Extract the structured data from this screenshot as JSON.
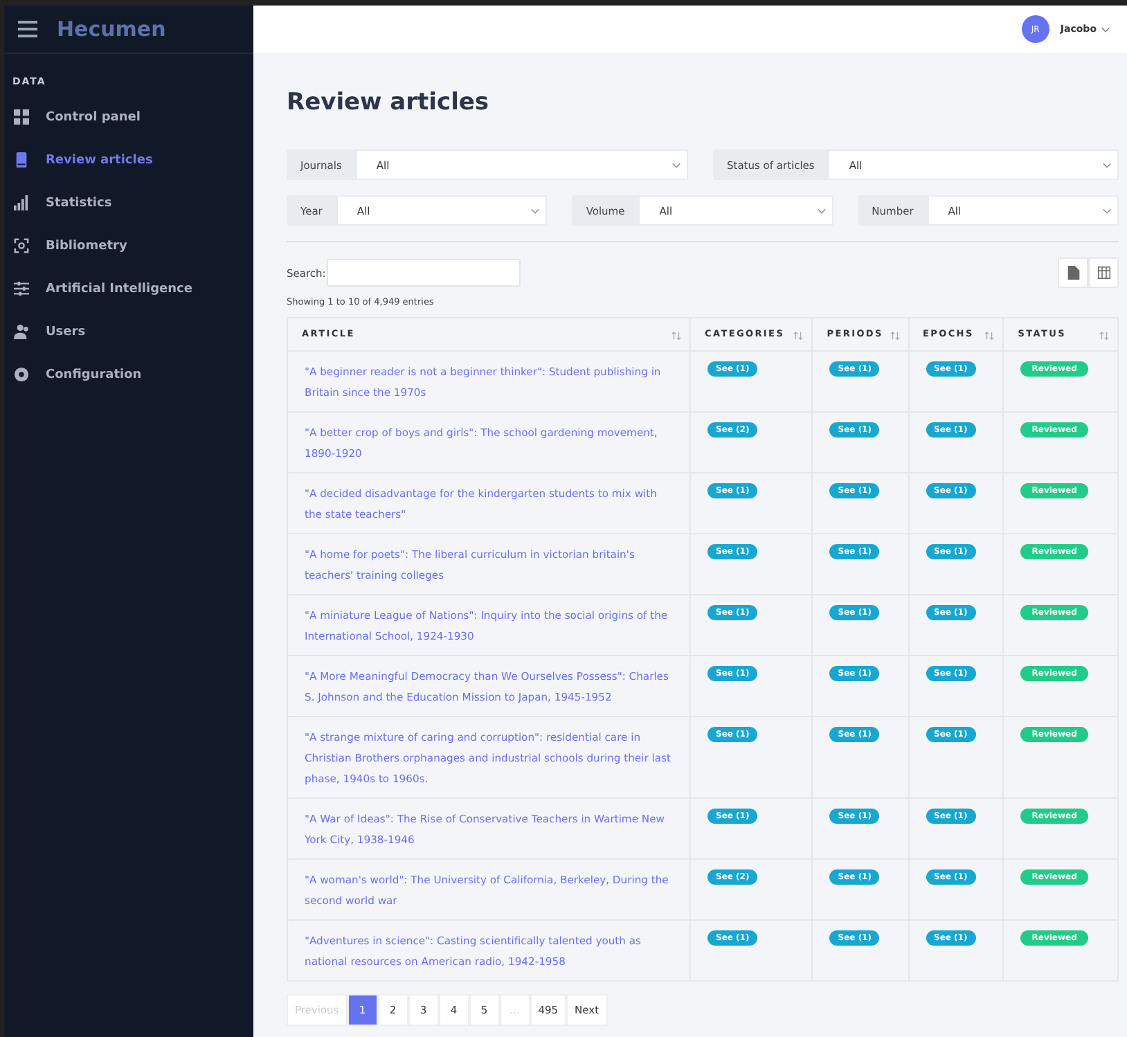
{
  "brand": "Hecumen",
  "sidebar": {
    "section": "DATA",
    "items": [
      {
        "label": "Control panel",
        "kind": "grid",
        "selected": false
      },
      {
        "label": "Review articles",
        "kind": "book",
        "selected": true
      },
      {
        "label": "Statistics",
        "kind": "bars",
        "selected": false
      },
      {
        "label": "Bibliometry",
        "kind": "scan",
        "selected": false
      },
      {
        "label": "Artificial Intelligence",
        "kind": "sliders",
        "selected": false
      },
      {
        "label": "Users",
        "kind": "users",
        "selected": false
      },
      {
        "label": "Configuration",
        "kind": "gear",
        "selected": false
      }
    ]
  },
  "user": {
    "initials": "JR",
    "name": "Jacobo"
  },
  "title": "Review articles",
  "filters": [
    [
      {
        "label": "Journals",
        "value": "All"
      },
      {
        "label": "Status of articles",
        "value": "All"
      }
    ],
    [
      {
        "label": "Year",
        "value": "All"
      },
      {
        "label": "Volume",
        "value": "All"
      },
      {
        "label": "Number",
        "value": "All"
      }
    ]
  ],
  "search": {
    "label": "Search:"
  },
  "info": "Showing 1 to 10 of 4,949 entries",
  "table": {
    "columns": [
      "ARTICLE",
      "CATEGORIES",
      "PERIODS",
      "EPOCHS",
      "STATUS"
    ],
    "rows": [
      {
        "article": "\"A beginner reader is not a beginner thinker\": Student publishing in Britain since the 1970s",
        "categories": "See (1)",
        "periods": "See (1)",
        "epochs": "See (1)",
        "status": "Reviewed"
      },
      {
        "article": "\"A better crop of boys and girls\": The school gardening movement, 1890-1920",
        "categories": "See (2)",
        "periods": "See (1)",
        "epochs": "See (1)",
        "status": "Reviewed"
      },
      {
        "article": "\"A decided disadvantage for the kindergarten students to mix with the state teachers\"",
        "categories": "See (1)",
        "periods": "See (1)",
        "epochs": "See (1)",
        "status": "Reviewed"
      },
      {
        "article": "\"A home for poets\": The liberal curriculum in victorian britain's teachers' training colleges",
        "categories": "See (1)",
        "periods": "See (1)",
        "epochs": "See (1)",
        "status": "Reviewed"
      },
      {
        "article": "\"A miniature League of Nations\": Inquiry into the social origins of the International School, 1924-1930",
        "categories": "See (1)",
        "periods": "See (1)",
        "epochs": "See (1)",
        "status": "Reviewed"
      },
      {
        "article": "\"A More Meaningful Democracy than We Ourselves Possess\": Charles S. Johnson and the Education Mission to Japan, 1945-1952",
        "categories": "See (1)",
        "periods": "See (1)",
        "epochs": "See (1)",
        "status": "Reviewed"
      },
      {
        "article": "\"A strange mixture of caring and corruption\": residential care in Christian Brothers orphanages and industrial schools during their last phase, 1940s to 1960s.",
        "categories": "See (1)",
        "periods": "See (1)",
        "epochs": "See (1)",
        "status": "Reviewed"
      },
      {
        "article": "\"A War of Ideas\": The Rise of Conservative Teachers in Wartime New York City, 1938-1946",
        "categories": "See (1)",
        "periods": "See (1)",
        "epochs": "See (1)",
        "status": "Reviewed"
      },
      {
        "article": "\"A woman's world\": The University of California, Berkeley, During the second world war",
        "categories": "See (2)",
        "periods": "See (1)",
        "epochs": "See (1)",
        "status": "Reviewed"
      },
      {
        "article": "\"Adventures in science\": Casting scientifically talented youth as national resources on American radio, 1942-1958",
        "categories": "See (1)",
        "periods": "See (1)",
        "epochs": "See (1)",
        "status": "Reviewed"
      }
    ]
  },
  "pagination": [
    {
      "label": "Previous",
      "selected": false,
      "disabled": true
    },
    {
      "label": "1",
      "selected": true,
      "disabled": false
    },
    {
      "label": "2",
      "selected": false,
      "disabled": false
    },
    {
      "label": "3",
      "selected": false,
      "disabled": false
    },
    {
      "label": "4",
      "selected": false,
      "disabled": false
    },
    {
      "label": "5",
      "selected": false,
      "disabled": false
    },
    {
      "label": "…",
      "selected": false,
      "disabled": true
    },
    {
      "label": "495",
      "selected": false,
      "disabled": false
    },
    {
      "label": "Next",
      "selected": false,
      "disabled": false
    }
  ]
}
